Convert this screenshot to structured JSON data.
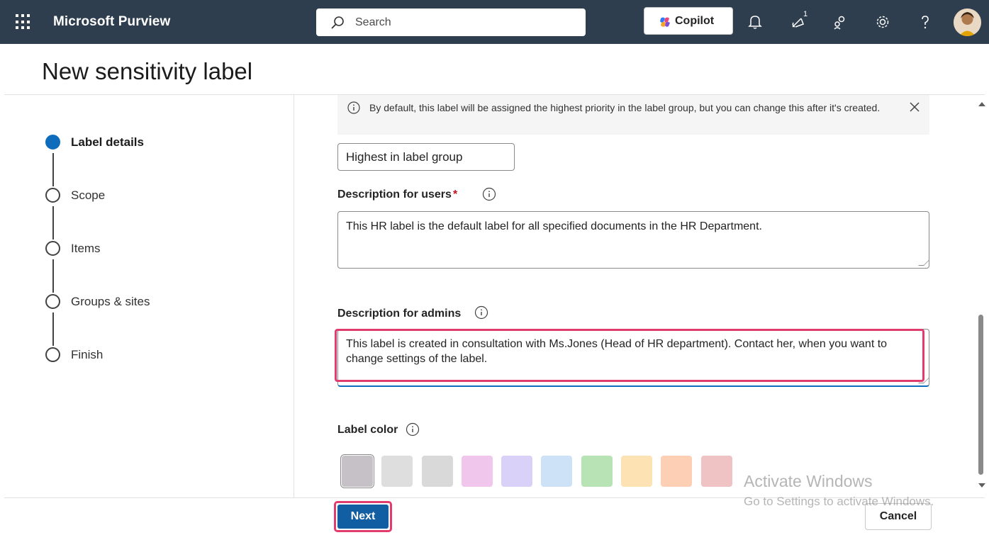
{
  "header": {
    "app_name": "Microsoft Purview",
    "search_placeholder": "Search",
    "copilot_label": "Copilot",
    "notification_badge": "1"
  },
  "page": {
    "title": "New sensitivity label"
  },
  "steps": [
    {
      "label": "Label details",
      "active": true
    },
    {
      "label": "Scope",
      "active": false
    },
    {
      "label": "Items",
      "active": false
    },
    {
      "label": "Groups & sites",
      "active": false
    },
    {
      "label": "Finish",
      "active": false
    }
  ],
  "form": {
    "info_message": "By default, this label will be assigned the highest priority in the label group, but you can change this after it's created.",
    "priority_value": "Highest in label group",
    "desc_users_label": "Description for users",
    "desc_users_required": "*",
    "desc_users_value": "This HR label is the default label for all specified documents in the HR Department.",
    "desc_admins_label": "Description for admins",
    "desc_admins_value": "This label is created in consultation with Ms.Jones (Head of HR department). Contact her, when you want to change settings of the label.",
    "label_color_label": "Label color",
    "colors": [
      "#c5c1c6",
      "#dedede",
      "#d9d9d9",
      "#f0c6ec",
      "#d9d1f7",
      "#cde1f7",
      "#b8e3b5",
      "#fde2b4",
      "#fdd0b6",
      "#efc2c3"
    ]
  },
  "footer": {
    "next_label": "Next",
    "cancel_label": "Cancel"
  },
  "watermark": {
    "line1": "Activate Windows",
    "line2": "Go to Settings to activate Windows."
  },
  "accent_color": "#0f6cbd",
  "highlight_color": "#e03c6e"
}
